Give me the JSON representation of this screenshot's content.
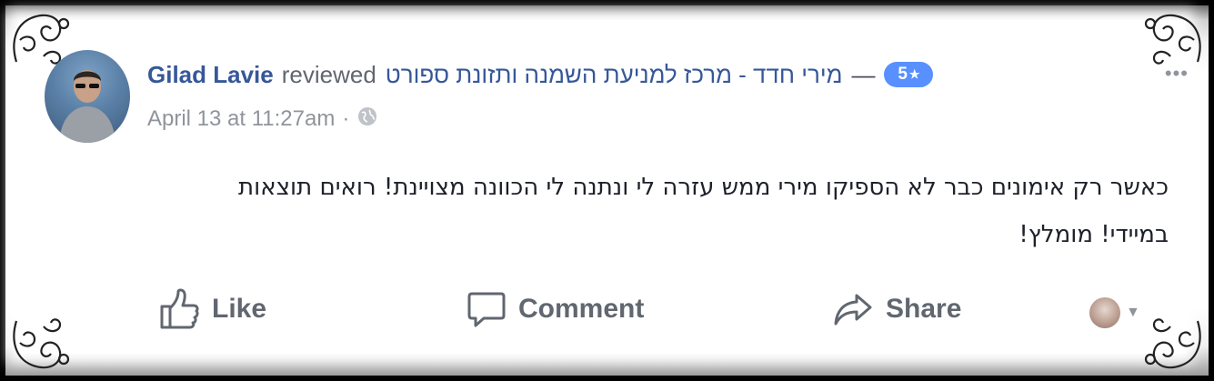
{
  "post": {
    "author_name": "Gilad Lavie",
    "verb": "reviewed",
    "page_name": "מירי חדד - מרכז למניעת השמנה ותזונת ספורט",
    "separator": "—",
    "rating": "5",
    "rating_icon": "star-icon",
    "timestamp": "April 13 at 11:27am",
    "meta_separator": "·",
    "privacy_icon": "globe-icon",
    "body_line1": "כאשר רק אימונים כבר לא הספיקו מירי ממש עזרה לי ונתנה לי הכוונה מצויינת! רואים תוצאות",
    "body_line2": "במיידי! מומלץ!"
  },
  "actions": {
    "like": "Like",
    "comment": "Comment",
    "share": "Share"
  },
  "colors": {
    "link": "#365899",
    "rating_badge": "#5890ff",
    "secondary_text": "#90949c",
    "body_text": "#1d2129",
    "action_text": "#616770"
  }
}
